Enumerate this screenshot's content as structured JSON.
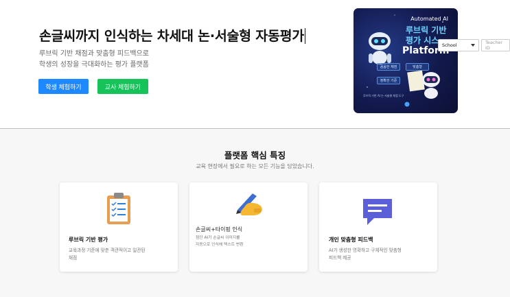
{
  "hero": {
    "title": "손글씨까지 인식하는 차세대 논·서술형 자동평가",
    "subtitle_line1": "루브릭 기반 채점과 맞춤형 피드백으로",
    "subtitle_line2": "학생의 성장을 극대화하는 평가 플랫폼",
    "student_button": "학생 체험하기",
    "teacher_button": "교사 체험하기"
  },
  "poster": {
    "top_label": "Automated AI",
    "line1": "루브릭 기반",
    "line2": "평가 시스",
    "line3": "Platform",
    "tags": [
      "꼼꼼한 채점",
      "맞춤형",
      "정확한 기준"
    ],
    "description": "루브릭 기반 AI 논·서술형 채점 도구"
  },
  "login": {
    "school_value": "School",
    "teacher_placeholder": "Teacher ID"
  },
  "features": {
    "title": "플랫폼 핵심 특징",
    "subtitle": "교육 현장에서 필요로 하는 모든 기능을 담았습니다.",
    "cards": [
      {
        "title": "루브릭 기반 평가",
        "desc1": "교육과정 기준에 맞춘 객관적이고 일관된",
        "desc2": "채점",
        "icon": "clipboard-checklist-icon"
      },
      {
        "title": "손글씨+타이핑 인식",
        "desc1": "첨단 AI가 손글씨 이미지를",
        "desc2": "자동으로 인식해 텍스트 변환",
        "icon": "writing-hand-icon"
      },
      {
        "title": "개인 맞춤형 피드백",
        "desc1": "AI가 생성한 명확하고 구체적인 맞춤형",
        "desc2": "피드백 제공",
        "icon": "chat-bubble-icon"
      }
    ]
  },
  "colors": {
    "student_button": "#1e88ff",
    "teacher_button": "#18c25a",
    "feedback_icon": "#5b5fd8"
  }
}
